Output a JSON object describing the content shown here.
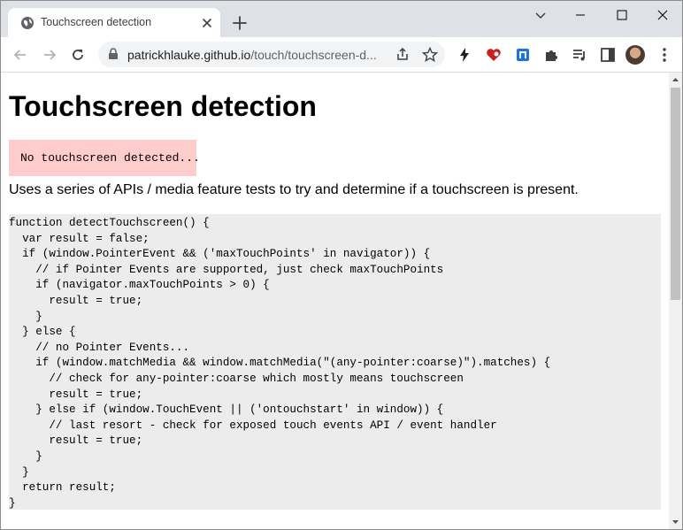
{
  "browser": {
    "tab": {
      "title": "Touchscreen detection"
    },
    "address_bar": {
      "url_host": "patrickhlauke.github.io",
      "url_path": "/touch/touchscreen-d..."
    }
  },
  "page": {
    "heading": "Touchscreen detection",
    "status_message": "No touchscreen detected...",
    "status_color": "#ffcccc",
    "description": "Uses a series of APIs / media feature tests to try and determine if a touchscreen is present.",
    "code_lines": [
      "function detectTouchscreen() {",
      "  var result = false;",
      "  if (window.PointerEvent && ('maxTouchPoints' in navigator)) {",
      "    // if Pointer Events are supported, just check maxTouchPoints",
      "    if (navigator.maxTouchPoints > 0) {",
      "      result = true;",
      "    }",
      "  } else {",
      "    // no Pointer Events...",
      "    if (window.matchMedia && window.matchMedia(\"(any-pointer:coarse)\").matches) {",
      "      // check for any-pointer:coarse which mostly means touchscreen",
      "      result = true;",
      "    } else if (window.TouchEvent || ('ontouchstart' in window)) {",
      "      // last resort - check for exposed touch events API / event handler",
      "      result = true;",
      "    }",
      "  }",
      "  return result;",
      "}"
    ]
  },
  "icons": {
    "tab_favicon": "globe-icon",
    "tab_close": "close-icon",
    "new_tab": "plus-icon",
    "back": "back-arrow-icon",
    "forward": "forward-arrow-icon",
    "reload": "reload-icon",
    "lock": "lock-icon",
    "share": "share-icon",
    "bookmark": "star-icon",
    "extensions": [
      "lightning-icon",
      "heart-extension-icon",
      "blue-extension-icon",
      "puzzle-icon",
      "media-control-icon",
      "side-panel-icon"
    ],
    "menu": "kebab-menu-icon"
  }
}
